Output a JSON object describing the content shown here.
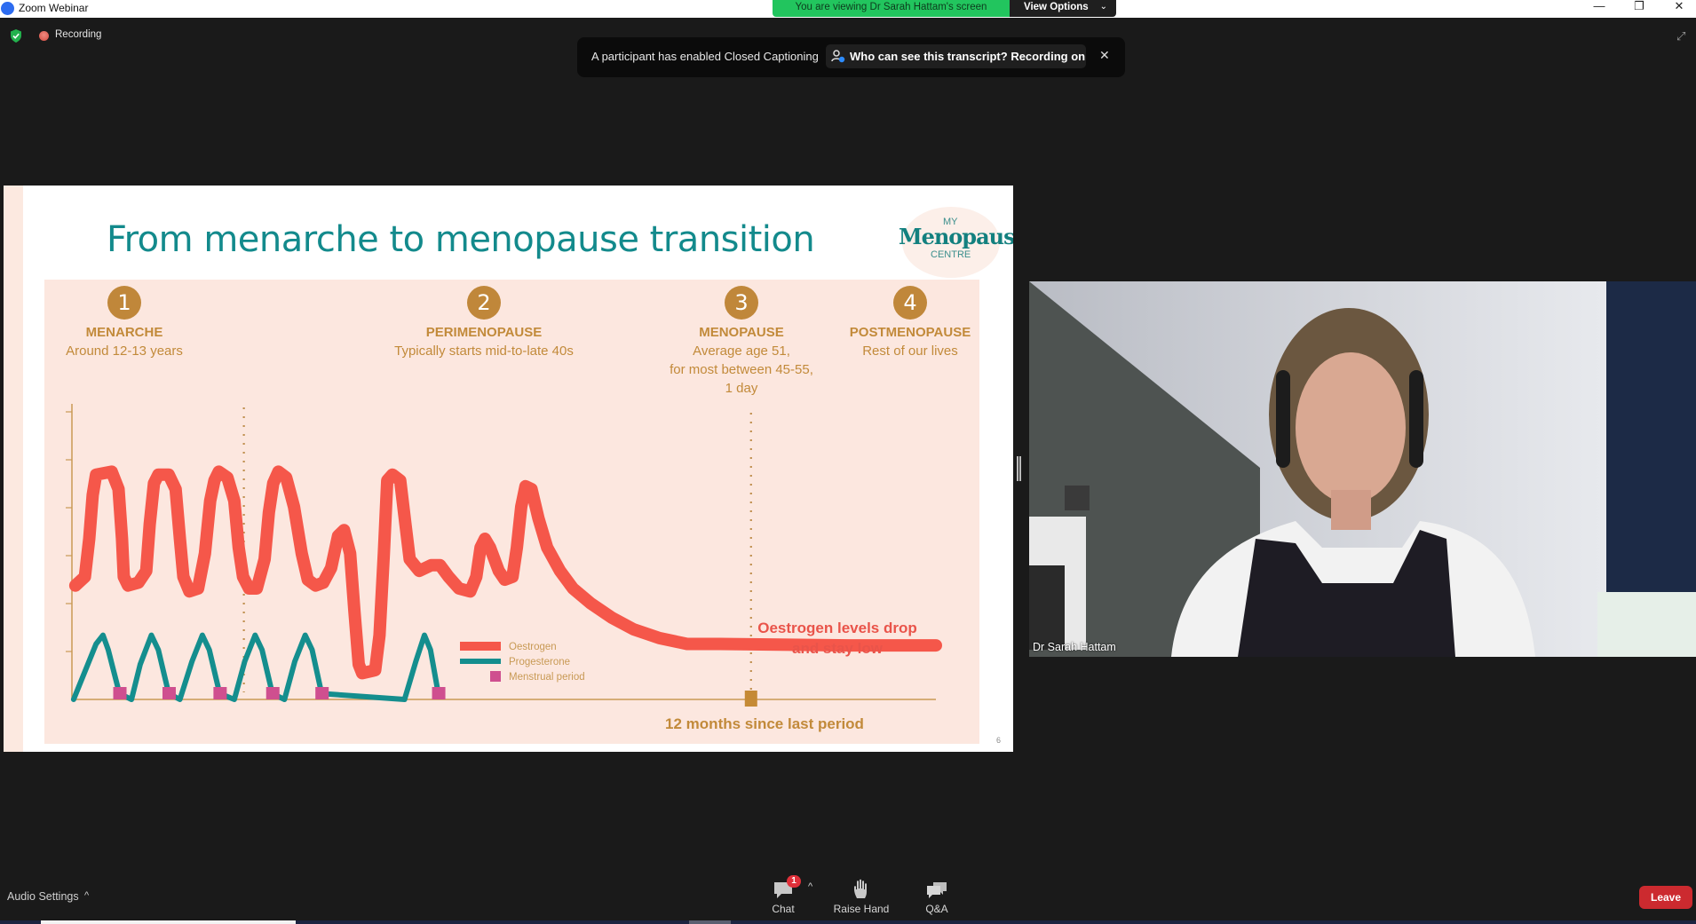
{
  "window": {
    "app_title": "Zoom Webinar",
    "viewing_banner": "You are viewing Dr Sarah Hattam's screen",
    "view_options_label": "View Options",
    "minimize_glyph": "—",
    "restore_glyph": "❐",
    "close_glyph": "✕"
  },
  "status": {
    "recording_label": "Recording",
    "security_icon": "shield-check-icon",
    "fullscreen_glyph": "⤢"
  },
  "caption_toast": {
    "message": "A participant has enabled Closed Captioning",
    "link_label": "Who can see this transcript? Recording on",
    "close_glyph": "✕"
  },
  "slide": {
    "title": "From menarche to menopause transition",
    "logo": {
      "top": "MY",
      "main": "Menopause",
      "bottom": "CENTRE"
    },
    "page_number": "6",
    "stages": [
      {
        "num": "1",
        "name": "MENARCHE",
        "desc": [
          "Around 12-13 years"
        ]
      },
      {
        "num": "2",
        "name": "PERIMENOPAUSE",
        "desc": [
          "Typically starts mid-to-late 40s"
        ]
      },
      {
        "num": "3",
        "name": "MENOPAUSE",
        "desc": [
          "Average age 51,",
          "for most between 45-55,",
          "1 day"
        ]
      },
      {
        "num": "4",
        "name": "POSTMENOPAUSE",
        "desc": [
          "Rest of our lives"
        ]
      }
    ]
  },
  "chart_data": {
    "type": "line",
    "title": "From menarche to menopause transition",
    "xlabel": "",
    "ylabel": "",
    "grid": false,
    "legend_position": "center",
    "x_range": [
      0,
      100
    ],
    "y_range": [
      0,
      100
    ],
    "legend": [
      {
        "name": "Oestrogen",
        "color": "#f5574a",
        "type": "line"
      },
      {
        "name": "Progesterone",
        "color": "#148e8e",
        "type": "line"
      },
      {
        "name": "Menstrual period",
        "color": "#cf4f8f",
        "type": "marker"
      }
    ],
    "series": [
      {
        "name": "Oestrogen",
        "color": "#f5574a",
        "points": [
          [
            0.4,
            39
          ],
          [
            1.5,
            42
          ],
          [
            2,
            55
          ],
          [
            2.4,
            70
          ],
          [
            2.8,
            77
          ],
          [
            4.6,
            78
          ],
          [
            5.4,
            72
          ],
          [
            5.8,
            55
          ],
          [
            6,
            42
          ],
          [
            6.5,
            39
          ],
          [
            7.7,
            40
          ],
          [
            8.6,
            44
          ],
          [
            9,
            60
          ],
          [
            9.5,
            74
          ],
          [
            10,
            77
          ],
          [
            11.2,
            77
          ],
          [
            12,
            72
          ],
          [
            12.5,
            55
          ],
          [
            12.9,
            42
          ],
          [
            13.6,
            37
          ],
          [
            14.6,
            38
          ],
          [
            15.4,
            50
          ],
          [
            16,
            68
          ],
          [
            16.5,
            75
          ],
          [
            17,
            78
          ],
          [
            18,
            76
          ],
          [
            18.8,
            68
          ],
          [
            19.3,
            52
          ],
          [
            19.8,
            42
          ],
          [
            20.5,
            38
          ],
          [
            21.4,
            38
          ],
          [
            22.3,
            48
          ],
          [
            22.8,
            64
          ],
          [
            23.3,
            74
          ],
          [
            23.9,
            78
          ],
          [
            24.8,
            76
          ],
          [
            25.7,
            66
          ],
          [
            26.6,
            50
          ],
          [
            27.3,
            41
          ],
          [
            28.2,
            39
          ],
          [
            29.1,
            40
          ],
          [
            30,
            45
          ],
          [
            30.8,
            56
          ],
          [
            31.5,
            58
          ],
          [
            32.2,
            50
          ],
          [
            32.7,
            30
          ],
          [
            33.2,
            12
          ],
          [
            33.6,
            9
          ],
          [
            35.1,
            10
          ],
          [
            35.6,
            22
          ],
          [
            36.1,
            50
          ],
          [
            36.5,
            75
          ],
          [
            37.1,
            77
          ],
          [
            38,
            75
          ],
          [
            38.6,
            60
          ],
          [
            39.1,
            48
          ],
          [
            40.2,
            44
          ],
          [
            41.6,
            46
          ],
          [
            42.6,
            46
          ],
          [
            43.6,
            42
          ],
          [
            44.8,
            38
          ],
          [
            46.1,
            37
          ],
          [
            46.8,
            42
          ],
          [
            47.3,
            52
          ],
          [
            47.8,
            55
          ],
          [
            48.4,
            52
          ],
          [
            49.4,
            44
          ],
          [
            50.1,
            41
          ],
          [
            51,
            42
          ],
          [
            51.5,
            52
          ],
          [
            52,
            66
          ],
          [
            52.5,
            73
          ],
          [
            53.2,
            72
          ],
          [
            54,
            62
          ],
          [
            55,
            52
          ],
          [
            56.5,
            44
          ],
          [
            58,
            38
          ],
          [
            60,
            33
          ],
          [
            62.5,
            28
          ],
          [
            65,
            24
          ],
          [
            68,
            21
          ],
          [
            71.2,
            19
          ],
          [
            75,
            19
          ],
          [
            90,
            18.5
          ],
          [
            100,
            18.5
          ]
        ]
      },
      {
        "name": "Progesterone",
        "color": "#148e8e",
        "points": [
          [
            0.2,
            0
          ],
          [
            2.8,
            19
          ],
          [
            3.6,
            22
          ],
          [
            4.2,
            17
          ],
          [
            5.5,
            2
          ],
          [
            6.9,
            0
          ],
          [
            7.9,
            12
          ],
          [
            9.2,
            22
          ],
          [
            10,
            17
          ],
          [
            11.2,
            2
          ],
          [
            12.5,
            0
          ],
          [
            13.9,
            13
          ],
          [
            15.1,
            22
          ],
          [
            15.9,
            17
          ],
          [
            17.1,
            2
          ],
          [
            18.8,
            0
          ],
          [
            20,
            13
          ],
          [
            21.2,
            22
          ],
          [
            22,
            17
          ],
          [
            23.2,
            2
          ],
          [
            24.6,
            0
          ],
          [
            25.8,
            13
          ],
          [
            27,
            22
          ],
          [
            27.8,
            17
          ],
          [
            28.9,
            2
          ],
          [
            38.5,
            0
          ],
          [
            39.8,
            13
          ],
          [
            40.8,
            22
          ],
          [
            41.5,
            17
          ],
          [
            42.4,
            2
          ]
        ]
      }
    ],
    "menstrual_periods_x": [
      5.5,
      11.2,
      17.1,
      23.2,
      28.9,
      42.4
    ],
    "vertical_markers": [
      {
        "x": 19.9,
        "style": "dotted",
        "label": ""
      },
      {
        "x": 78.6,
        "style": "dotted",
        "label": "12 months since last period"
      }
    ],
    "final_period_marker_x": 78.6,
    "annotations": [
      {
        "text": "Oestrogen levels drop and stay low",
        "lines": [
          "Oestrogen levels drop",
          "and stay low"
        ],
        "color": "#e9544a"
      },
      {
        "text": "12 months since last period",
        "color": "#c28a3a"
      }
    ],
    "y_tick_count": 6,
    "categories": [
      "Menarche",
      "Perimenopause",
      "Menopause",
      "Postmenopause"
    ]
  },
  "video": {
    "participant_name": "Dr Sarah Hattam"
  },
  "toolbar": {
    "audio_settings_label": "Audio Settings",
    "audio_chevron": "^",
    "chat_label": "Chat",
    "chat_badge": "1",
    "chat_chevron": "^",
    "raise_hand_label": "Raise Hand",
    "qa_label": "Q&A",
    "leave_label": "Leave"
  }
}
